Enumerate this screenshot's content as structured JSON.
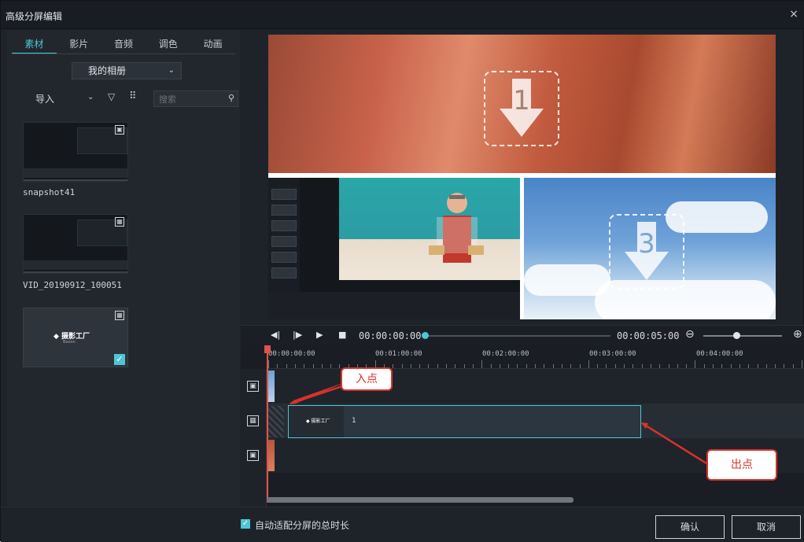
{
  "window": {
    "title": "高级分屏编辑",
    "close_glyph": "×"
  },
  "left_panel": {
    "tabs": [
      {
        "label": "素材",
        "active": true
      },
      {
        "label": "影片",
        "active": false
      },
      {
        "label": "音频",
        "active": false
      },
      {
        "label": "调色",
        "active": false
      },
      {
        "label": "动画",
        "active": false
      }
    ],
    "album_select": {
      "value": "我的相册"
    },
    "toolbar": {
      "import_label": "导入",
      "search_placeholder": "搜索"
    },
    "media": [
      {
        "name": "snapshot41",
        "icon": "image-icon"
      },
      {
        "name": "VID_20190912_100051",
        "icon": "film-icon"
      },
      {
        "name": "",
        "logo_text": "◆ 摄影工厂",
        "logo_sub": "Beeon",
        "checked": true,
        "icon": "film-icon"
      }
    ]
  },
  "preview": {
    "zones": [
      {
        "number": "1"
      },
      {
        "number": ""
      },
      {
        "number": "3"
      }
    ]
  },
  "transport": {
    "current_time": "00:00:00:00",
    "total_time": "00:00:05:00"
  },
  "timeline": {
    "ruler_labels": [
      "00:00:00:00",
      "00:01:00:00",
      "00:02:00:00",
      "00:03:00:00",
      "00:04:00:00"
    ],
    "clip": {
      "logo_text": "◆ 摄影工厂",
      "label": "1"
    },
    "tracks": [
      {
        "icon": "image-icon"
      },
      {
        "icon": "film-icon"
      },
      {
        "icon": "image-icon"
      }
    ]
  },
  "annotations": {
    "in_point": "入点",
    "out_point": "出点",
    "color": "#d8322a"
  },
  "bottom_bar": {
    "auto_fit_label": "自动适配分屏的总时长",
    "auto_fit_checked": true,
    "confirm_label": "确认",
    "cancel_label": "取消"
  },
  "colors": {
    "accent": "#4ec6d4",
    "background": "#1e232a",
    "playhead": "#e0534c"
  }
}
